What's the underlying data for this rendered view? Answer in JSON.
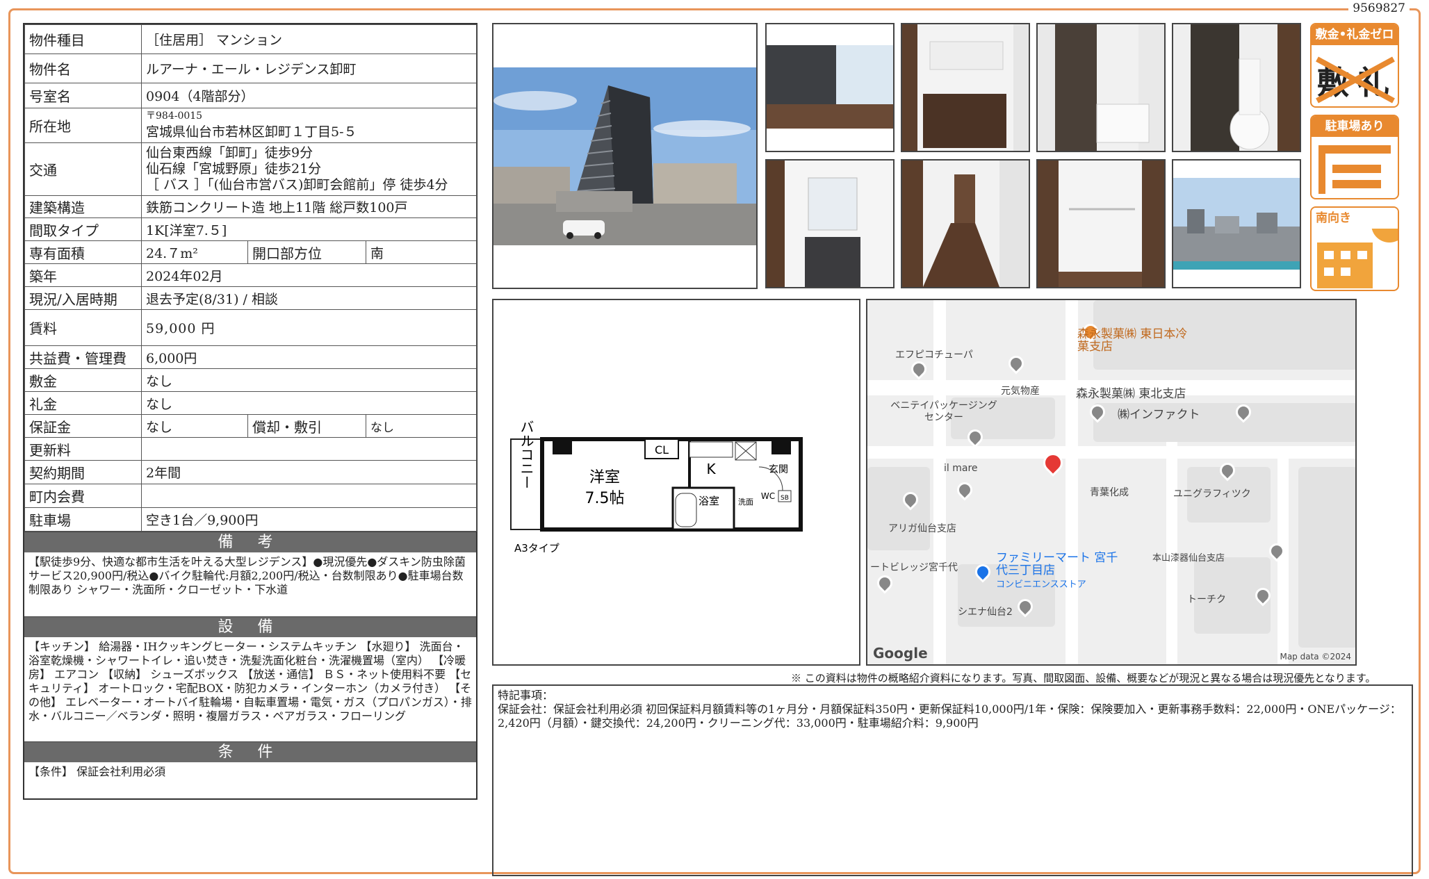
{
  "doc_number": "9569827",
  "spec": {
    "property_type": {
      "label": "物件種目",
      "value": "［住居用］ マンション"
    },
    "property_name": {
      "label": "物件名",
      "value": "ルアーナ・エール・レジデンス卸町"
    },
    "room_no": {
      "label": "号室名",
      "value": "0904（4階部分）"
    },
    "address": {
      "label": "所在地",
      "zip": "〒984-0015",
      "value": "宮城県仙台市若林区卸町１丁目5-５"
    },
    "transport": {
      "label": "交通",
      "lines": [
        "仙台東西線「卸町」徒歩9分",
        "仙石線「宮城野原」徒歩21分",
        "［ バス ］「(仙台市営バス)卸町会館前」停 徒歩4分"
      ]
    },
    "structure": {
      "label": "建築構造",
      "value": "鉄筋コンクリート造 地上11階 総戸数100戸"
    },
    "layout": {
      "label": "間取タイプ",
      "value": "1K[洋室7.５]"
    },
    "area": {
      "label": "専有面積",
      "value": "24.７m²",
      "dir_label": "開口部方位",
      "dir_value": "南"
    },
    "built": {
      "label": "築年",
      "value": "2024年02月"
    },
    "status": {
      "label": "現況/入居時期",
      "value": "退去予定(8/31) / 相談"
    },
    "rent": {
      "label": "賃料",
      "value": "59,000 円"
    },
    "mgmt_fee": {
      "label": "共益費・管理費",
      "value": "6,000円"
    },
    "deposit": {
      "label": "敷金",
      "value": "なし"
    },
    "key_money": {
      "label": "礼金",
      "value": "なし"
    },
    "guarantee": {
      "label": "保証金",
      "value": "なし",
      "amort_label": "償却・敷引",
      "amort_value": "なし"
    },
    "renewal": {
      "label": "更新料",
      "value": ""
    },
    "contract": {
      "label": "契約期間",
      "value": "2年間"
    },
    "community_fee": {
      "label": "町内会費",
      "value": ""
    },
    "parking": {
      "label": "駐車場",
      "value": "空き1台／9,900円"
    }
  },
  "remarks": {
    "title": "備 考",
    "text": "【駅徒歩9分、快適な都市生活を叶える大型レジデンス】●現況優先●ダスキン防虫除菌サービス20,900円/税込●バイク駐輪代:月額2,200円/税込・台数制限あり●駐車場台数制限あり シャワー・洗面所・クローゼット・下水道"
  },
  "facilities": {
    "title": "設 備",
    "text": "【キッチン】 給湯器・IHクッキングヒーター・システムキッチン 【水廻り】 洗面台・浴室乾燥機・シャワートイレ・追い焚き・洗髪洗面化粧台・洗濯機置場（室内） 【冷暖房】 エアコン 【収納】 シューズボックス 【放送・通信】 ＢＳ・ネット使用料不要 【セキュリティ】 オートロック・宅配BOX・防犯カメラ・インターホン（カメラ付き） 【その他】 エレベーター・オートバイ駐輪場・自転車置場・電気・ガス（プロパンガス）・排水・バルコニー／ベランダ・照明・複層ガラス・ペアガラス・フローリング"
  },
  "conditions": {
    "title": "条 件",
    "text": "【条件】 保証会社利用必須"
  },
  "badges": [
    "敷金•礼金ゼロ",
    "駐車場あり",
    "南向き"
  ],
  "badge_glyphs": {
    "shiki": "敷",
    "rei": "礼"
  },
  "floorplan": {
    "balcony": "バルコニー",
    "room": "洋室",
    "room_size": "7.5帖",
    "cl": "CL",
    "kitchen": "K",
    "entrance": "玄関",
    "bath": "浴室",
    "wc": "WC",
    "wash": "洗面",
    "sb": "SB",
    "type_label": "A3タイプ"
  },
  "map": {
    "labels": [
      "エフピコチューパ",
      "元気物産",
      "森永製菓㈱ 東日本冷菓支店",
      "森永製菓㈱ 東北支店",
      "㈱インファクト",
      "ベニテイパッケージング センター",
      "il mare",
      "青葉化成",
      "ユニグラフィツク",
      "アリガ仙台支店",
      "ートビレッジ宮千代",
      "ファミリーマート 宮千代三丁目店",
      "コンビニエンスストア",
      "本山漆器仙台支店",
      "シエナ仙台2",
      "トーチク"
    ],
    "logo": "Google",
    "credit": "Map data ©2024"
  },
  "disclaimer": "※ この資料は物件の概略紹介資料になります。写真、間取図面、設備、概要などが現況と異なる場合は現況優先となります。",
  "special_notes": {
    "title": "特記事項：",
    "text": "保証会社：保証会社利用必須 初回保証料月額賃料等の1ヶ月分・月額保証料350円・更新保証料10,000円/1年・保険：保険要加入・更新事務手数料：22,000円・ONEパッケージ：2,420円（月額）・鍵交換代：24,200円・クリーニング代：33,000円・駐車場紹介料：9,900円"
  }
}
